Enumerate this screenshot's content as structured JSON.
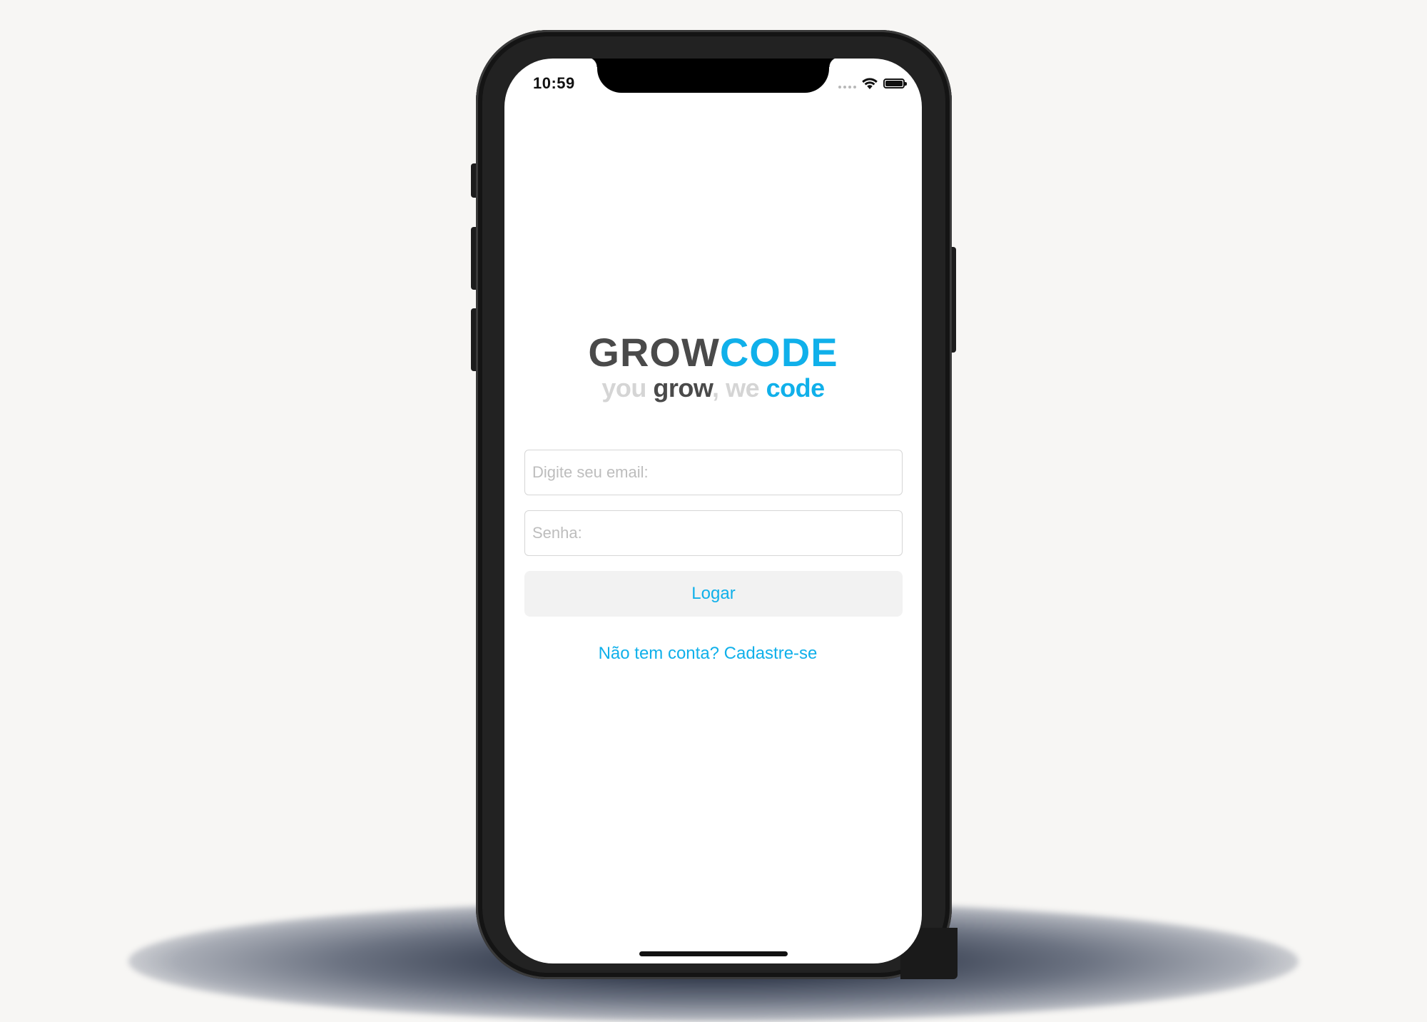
{
  "status_bar": {
    "time": "10:59",
    "icons": [
      "signal-dots-icon",
      "wifi-icon",
      "battery-icon"
    ]
  },
  "logo": {
    "word_grow": "GROW",
    "word_code": "CODE",
    "tagline": {
      "you": "you",
      "grow": "grow",
      "comma": ",",
      "we": "we",
      "code": "code"
    }
  },
  "form": {
    "email_placeholder": "Digite seu email:",
    "email_value": "",
    "password_placeholder": "Senha:",
    "password_value": "",
    "login_label": "Logar",
    "signup_label": "Não tem conta? Cadastre-se"
  },
  "colors": {
    "accent": "#10b0ea",
    "logo_dark": "#4a4a4a",
    "logo_light": "#d5d5d5",
    "button_bg": "#f2f2f2",
    "background": "#f7f6f4"
  }
}
